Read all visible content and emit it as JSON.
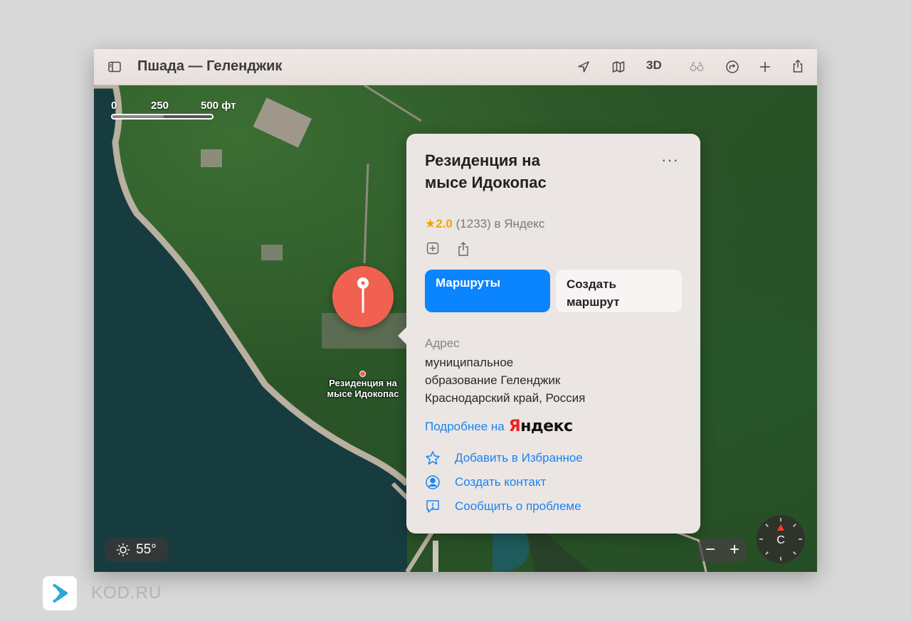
{
  "window": {
    "title": "Пшада — Геленджик"
  },
  "toolbar": {
    "threed_label": "3D",
    "icons": [
      "sidebar-icon",
      "location-arrow-icon",
      "map-icon",
      "binoculars-icon",
      "route-arrow-icon",
      "plus-icon",
      "share-icon"
    ]
  },
  "map": {
    "scale": {
      "zero": "0",
      "mid": "250",
      "end": "500 фт"
    },
    "pin_label_line1": "Резиденция на",
    "pin_label_line2": "мысе Идокопас",
    "weather": "55°",
    "zoom_out": "−",
    "zoom_in": "+",
    "compass": "С"
  },
  "place": {
    "title_line1": "Резиденция на",
    "title_line2": "мысе Идокопас",
    "more_menu": "···",
    "rating_star": "★",
    "rating_value": "2.0",
    "rating_count": "(1233) в Яндекс",
    "btn_routes": "Маршруты",
    "btn_create_route_line1": "Создать",
    "btn_create_route_line2": "маршрут",
    "address_label": "Адрес",
    "address_line1": "муниципальное",
    "address_line2": "образование Геленджик",
    "address_line3": "Краснодарский край, Россия",
    "more_link": "Подробнее на",
    "yandex_first": "Я",
    "yandex_rest": "ндекс",
    "actions": {
      "favorite": "Добавить в Избранное",
      "contact": "Создать контакт",
      "report": "Сообщить о проблеме"
    }
  },
  "branding": {
    "text": "KOD.RU"
  },
  "colors": {
    "accent": "#0a84ff",
    "pin": "#f06152",
    "star": "#f2a400"
  }
}
